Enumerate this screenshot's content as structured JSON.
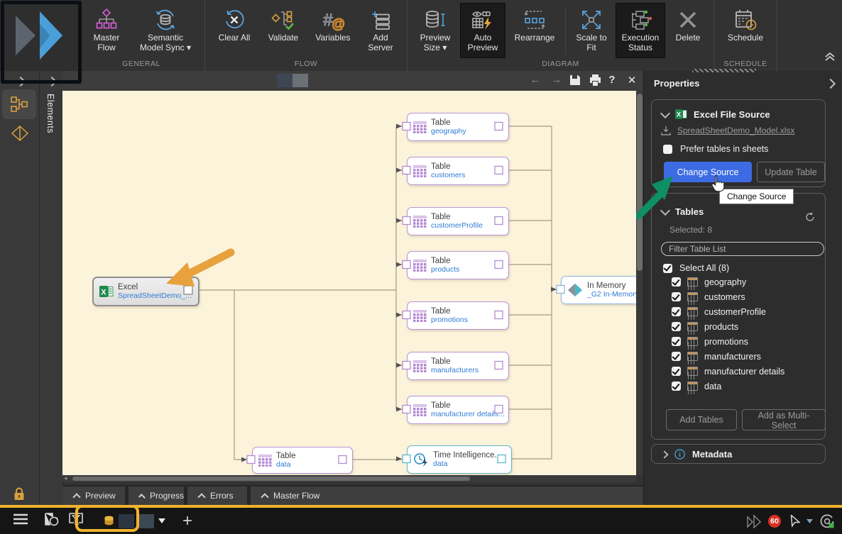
{
  "ribbon": {
    "groups": [
      {
        "label": "GENERAL",
        "items": [
          {
            "label": "Master Flow"
          },
          {
            "label": "Semantic Model Sync ▾"
          }
        ]
      },
      {
        "label": "FLOW",
        "items": [
          {
            "label": "Clear All"
          },
          {
            "label": "Validate"
          },
          {
            "label": "Variables"
          },
          {
            "label": "Add Server"
          }
        ]
      },
      {
        "label": "DIAGRAM",
        "items": [
          {
            "label": "Preview Size ▾"
          },
          {
            "label": "Auto Preview",
            "active": true
          },
          {
            "label": "Rearrange"
          },
          {
            "label": "Scale to Fit"
          },
          {
            "label": "Execution Status",
            "active": true
          },
          {
            "label": "Delete"
          }
        ]
      },
      {
        "label": "SCHEDULE",
        "items": [
          {
            "label": "Schedule"
          }
        ]
      }
    ]
  },
  "sidebar": {
    "elements_label": "Elements"
  },
  "canvas_toolbar": {
    "back": "←",
    "forward": "→",
    "help": "?",
    "close": "✕"
  },
  "diagram": {
    "nodes": [
      {
        "title": "Excel",
        "subtitle": "SpreadSheetDemo_..."
      },
      {
        "title": "Table",
        "subtitle": "geography"
      },
      {
        "title": "Table",
        "subtitle": "customers"
      },
      {
        "title": "Table",
        "subtitle": "customerProfile"
      },
      {
        "title": "Table",
        "subtitle": "products"
      },
      {
        "title": "Table",
        "subtitle": "promotions"
      },
      {
        "title": "Table",
        "subtitle": "manufacturers"
      },
      {
        "title": "Table",
        "subtitle": "manufacturer details..."
      },
      {
        "title": "Table",
        "subtitle": "data"
      },
      {
        "title": "Time Intelligence...",
        "subtitle": "data"
      },
      {
        "title": "In Memory",
        "subtitle": "_G2 In-Memory"
      }
    ]
  },
  "bottom_tabs": [
    {
      "label": "Preview"
    },
    {
      "label": "Progress"
    },
    {
      "label": "Errors"
    },
    {
      "label": "Master Flow"
    }
  ],
  "properties": {
    "title": "Properties",
    "source": {
      "title": "Excel File Source",
      "file_link": "SpreadSheetDemo_Model.xlsx",
      "checkbox_label": "Prefer tables in sheets",
      "checkbox_checked": false,
      "change_source": "Change Source",
      "update_table": "Update Table",
      "tooltip": "Change Source"
    },
    "tables": {
      "title": "Tables",
      "selected": "Selected: 8",
      "filter_placeholder": "Filter Table List",
      "select_all": "Select All (8)",
      "items": [
        {
          "name": "geography"
        },
        {
          "name": "customers"
        },
        {
          "name": "customerProfile"
        },
        {
          "name": "products"
        },
        {
          "name": "promotions"
        },
        {
          "name": "manufacturers"
        },
        {
          "name": "manufacturer details"
        },
        {
          "name": "data"
        }
      ],
      "add_tables": "Add Tables",
      "add_multi": "Add as Multi-Select"
    },
    "metadata": {
      "title": "Metadata"
    }
  },
  "status_bar": {
    "badge_count": "60"
  },
  "annotation_colors": {
    "yellow": "#F2B32B",
    "orange": "#E8A13C",
    "green": "#0F8F66",
    "black": "#0B0F15"
  }
}
